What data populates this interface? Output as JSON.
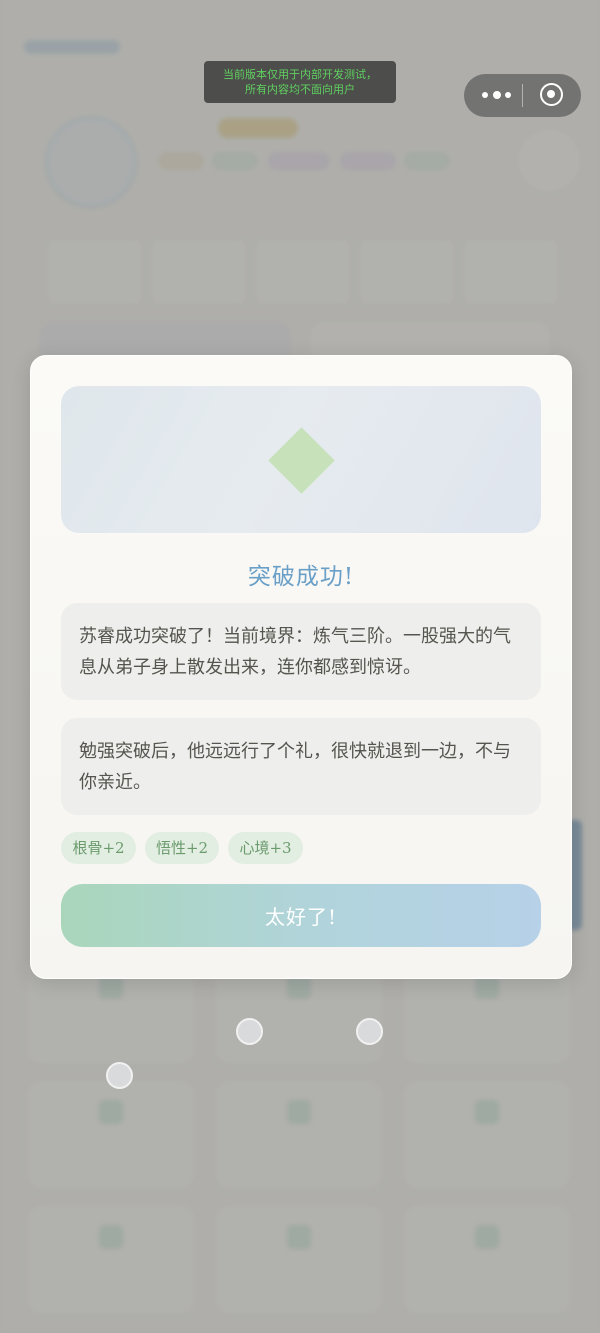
{
  "dev_notice": {
    "line1": "当前版本仅用于内部开发测试，",
    "line2": "所有内容均不面向用户"
  },
  "capsule": {
    "more_icon": "more-dots-icon",
    "close_icon": "target-close-icon"
  },
  "modal": {
    "hero_icon": "diamond-icon",
    "hero_color": "#c7e1ba",
    "title": "突破成功!",
    "message_1": "苏睿成功突破了！当前境界：炼气三阶。一股强大的气息从弟子身上散发出来，连你都感到惊讶。",
    "message_2": "勉强突破后，他远远行了个礼，很快就退到一边，不与你亲近。",
    "tags": [
      "根骨+2",
      "悟性+2",
      "心境+3"
    ],
    "confirm_label": "太好了!",
    "title_color": "#6a9fc7",
    "tag_text_color": "#6b9b6d"
  },
  "colors": {
    "dim_overlay": "rgba(120,120,116,0.55)",
    "button_gradient_start": "#a9d6bb",
    "button_gradient_end": "#b6d1e8"
  }
}
